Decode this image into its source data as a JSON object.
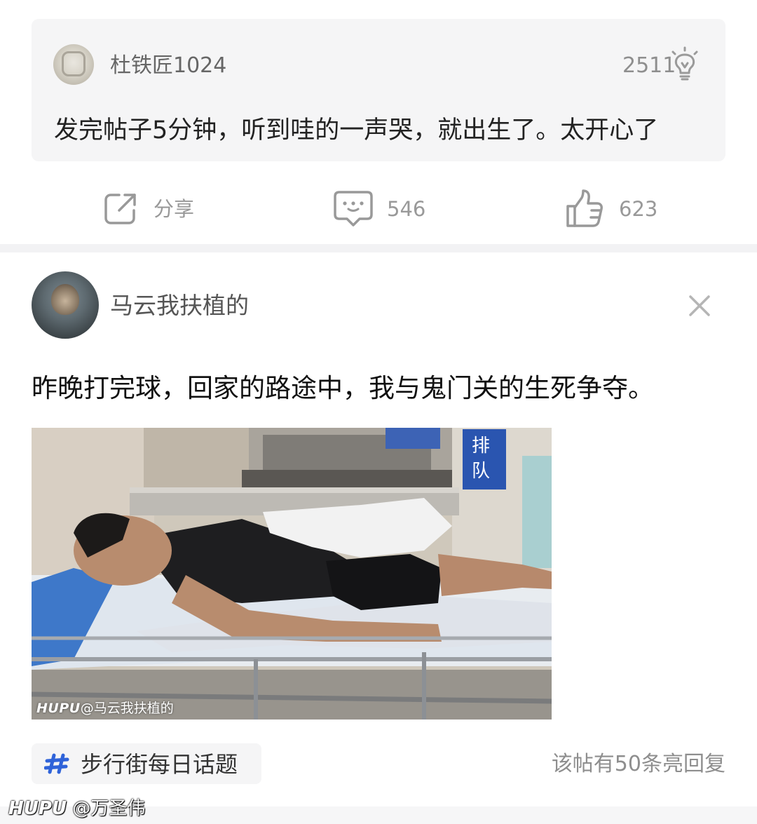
{
  "comment": {
    "author": "杜铁匠1024",
    "light_count": "2511",
    "text": "发完帖子5分钟，听到哇的一声哭，就出生了。太开心了"
  },
  "actions": {
    "share_label": "分享",
    "reply_count": "546",
    "like_count": "623"
  },
  "post": {
    "author": "马云我扶植的",
    "title": "昨晚打完球，回家的路途中，我与鬼门关的生死争夺。",
    "image_watermark_brand": "HUPU",
    "image_watermark_user": "@马云我扶植的",
    "image_sign_text": "排队"
  },
  "footer": {
    "topic_label": "步行街每日话题",
    "reply_note": "该帖有50条亮回复"
  },
  "page_watermark": {
    "brand": "HUPU",
    "user": "@万圣伟"
  },
  "colors": {
    "card_bg": "#f5f5f6",
    "accent_blue": "#2f63d9",
    "muted_text": "#999999"
  }
}
